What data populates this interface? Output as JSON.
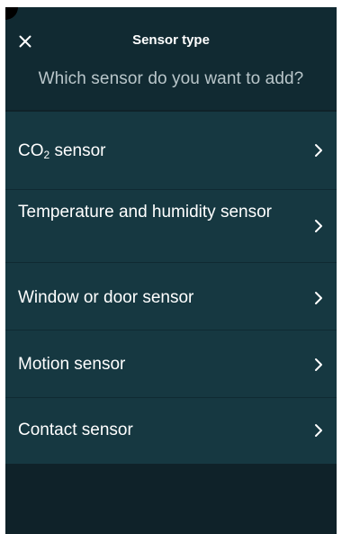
{
  "header": {
    "title": "Sensor type",
    "subtitle": "Which sensor do you want to add?",
    "close_icon": "close-icon"
  },
  "sensor_list": [
    {
      "label_main": "CO",
      "label_sub": "2",
      "label_rest": " sensor"
    },
    {
      "label": "Temperature and humidity sensor"
    },
    {
      "label": "Window or door sensor"
    },
    {
      "label": "Motion sensor"
    },
    {
      "label": "Contact sensor"
    }
  ],
  "icons": {
    "chevron": "chevron-right-icon"
  },
  "colors": {
    "background": "#0f2229",
    "header": "#112a32",
    "list": "#163841",
    "text": "#ffffff",
    "subtitle": "#b9c6ca"
  }
}
